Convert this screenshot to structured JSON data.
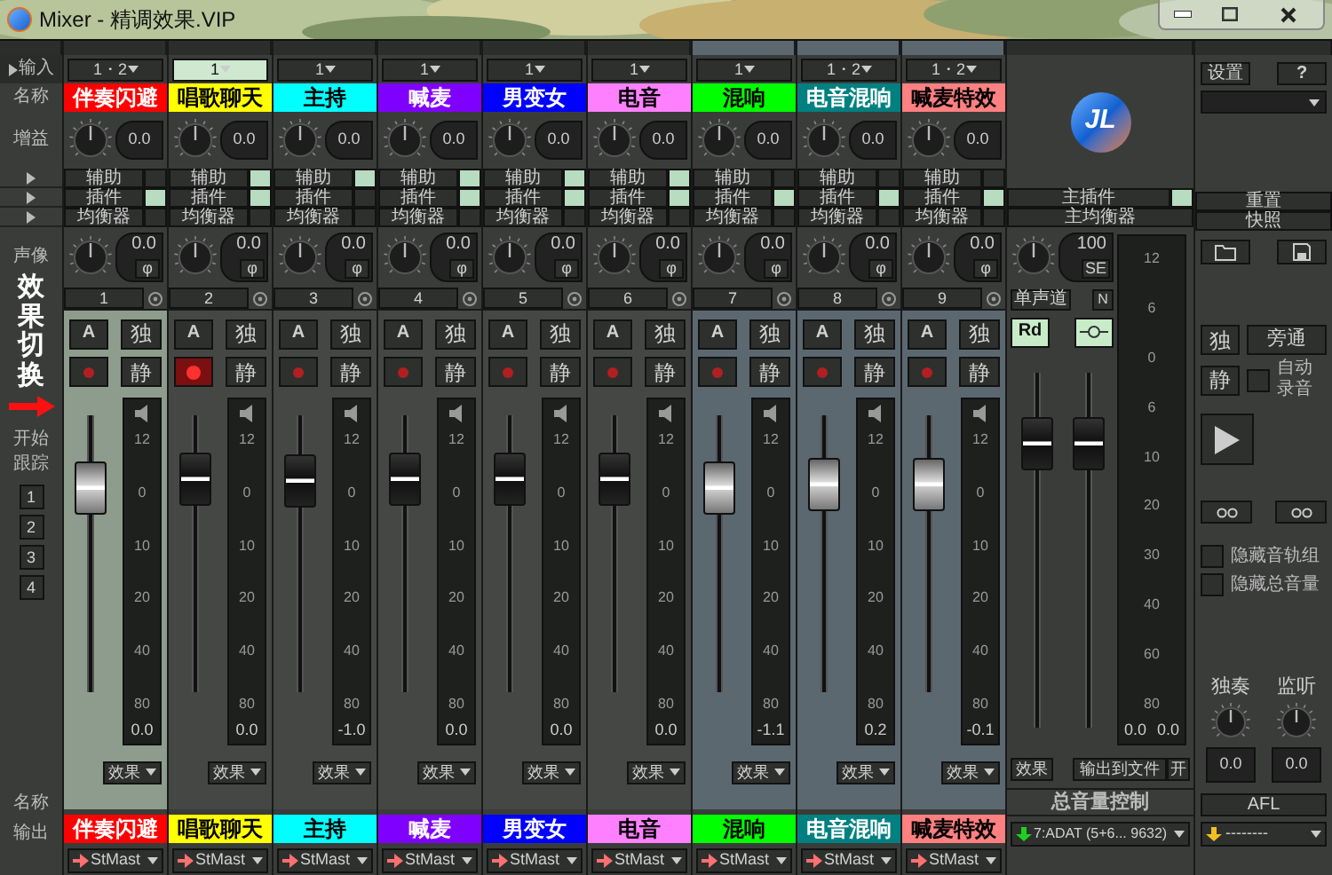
{
  "window": {
    "title": "Mixer - 精调效果.VIP"
  },
  "labels": {
    "input": "输入",
    "name": "名称",
    "gain": "增益",
    "pan": "声像",
    "switch": "效果切换",
    "start": "开始",
    "track": "跟踪",
    "presets": [
      "1",
      "2",
      "3",
      "4"
    ],
    "name_bottom": "名称",
    "output": "输出"
  },
  "channels": [
    {
      "number": "1",
      "input": "1・2",
      "input_active": false,
      "name": "伴奏闪避",
      "color": "#ff0000",
      "gain": "0.0",
      "aux": "辅助",
      "aux_on": false,
      "plugin": "插件",
      "plugin_on": true,
      "eq": "均衡器",
      "pan": "0.0",
      "phase": "φ",
      "auto": "A",
      "solo": "独",
      "mute": "静",
      "record": false,
      "selected": true,
      "grouped": false,
      "level": 0.74,
      "meter_scale": [
        "12",
        "0",
        "10",
        "20",
        "40",
        "80"
      ],
      "reading": "0.0",
      "effect": "效果",
      "name_bottom": "伴奏闪避",
      "output": "StMast"
    },
    {
      "number": "2",
      "input": "1",
      "input_active": true,
      "name": "唱歌聊天",
      "color": "#ffff00",
      "gain": "0.0",
      "aux": "辅助",
      "aux_on": true,
      "plugin": "插件",
      "plugin_on": true,
      "eq": "均衡器",
      "pan": "0.0",
      "phase": "φ",
      "auto": "A",
      "solo": "独",
      "mute": "静",
      "record": true,
      "selected": false,
      "grouped": false,
      "level": 0.77,
      "meter_scale": [
        "12",
        "0",
        "10",
        "20",
        "40",
        "80"
      ],
      "reading": "0.0",
      "effect": "效果",
      "name_bottom": "唱歌聊天",
      "output": "StMast"
    },
    {
      "number": "3",
      "input": "1",
      "input_active": false,
      "name": "主持",
      "color": "#00ffff",
      "gain": "0.0",
      "aux": "辅助",
      "aux_on": true,
      "plugin": "插件",
      "plugin_on": false,
      "eq": "均衡器",
      "pan": "0.0",
      "phase": "φ",
      "auto": "A",
      "solo": "独",
      "mute": "静",
      "record": false,
      "selected": false,
      "grouped": false,
      "level": 0.76,
      "meter_scale": [
        "12",
        "0",
        "10",
        "20",
        "40",
        "80"
      ],
      "reading": "-1.0",
      "effect": "效果",
      "name_bottom": "主持",
      "output": "StMast"
    },
    {
      "number": "4",
      "input": "1",
      "input_active": false,
      "name": "喊麦",
      "color": "#8000ff",
      "gain": "0.0",
      "aux": "辅助",
      "aux_on": true,
      "plugin": "插件",
      "plugin_on": true,
      "eq": "均衡器",
      "pan": "0.0",
      "phase": "φ",
      "auto": "A",
      "solo": "独",
      "mute": "静",
      "record": false,
      "selected": false,
      "grouped": false,
      "level": 0.77,
      "meter_scale": [
        "12",
        "0",
        "10",
        "20",
        "40",
        "80"
      ],
      "reading": "0.0",
      "effect": "效果",
      "name_bottom": "喊麦",
      "output": "StMast"
    },
    {
      "number": "5",
      "input": "1",
      "input_active": false,
      "name": "男变女",
      "color": "#0000ff",
      "gain": "0.0",
      "aux": "辅助",
      "aux_on": true,
      "plugin": "插件",
      "plugin_on": true,
      "eq": "均衡器",
      "pan": "0.0",
      "phase": "φ",
      "auto": "A",
      "solo": "独",
      "mute": "静",
      "record": false,
      "selected": false,
      "grouped": false,
      "level": 0.77,
      "meter_scale": [
        "12",
        "0",
        "10",
        "20",
        "40",
        "80"
      ],
      "reading": "0.0",
      "effect": "效果",
      "name_bottom": "男变女",
      "output": "StMast"
    },
    {
      "number": "6",
      "input": "1",
      "input_active": false,
      "name": "电音",
      "color": "#ff80ff",
      "gain": "0.0",
      "aux": "辅助",
      "aux_on": true,
      "plugin": "插件",
      "plugin_on": true,
      "eq": "均衡器",
      "pan": "0.0",
      "phase": "φ",
      "auto": "A",
      "solo": "独",
      "mute": "静",
      "record": false,
      "selected": false,
      "grouped": false,
      "level": 0.77,
      "meter_scale": [
        "12",
        "0",
        "10",
        "20",
        "40",
        "80"
      ],
      "reading": "0.0",
      "effect": "效果",
      "name_bottom": "电音",
      "output": "StMast"
    },
    {
      "number": "7",
      "input": "1",
      "input_active": false,
      "name": "混响",
      "color": "#00ff00",
      "gain": "0.0",
      "aux": "辅助",
      "aux_on": false,
      "plugin": "插件",
      "plugin_on": true,
      "eq": "均衡器",
      "pan": "0.0",
      "phase": "φ",
      "auto": "A",
      "solo": "独",
      "mute": "静",
      "record": false,
      "selected": false,
      "grouped": true,
      "level": 0.74,
      "meter_scale": [
        "12",
        "0",
        "10",
        "20",
        "40",
        "80"
      ],
      "reading": "-1.1",
      "effect": "效果",
      "name_bottom": "混响",
      "output": "StMast"
    },
    {
      "number": "8",
      "input": "1・2",
      "input_active": false,
      "name": "电音混响",
      "color": "#008080",
      "gain": "0.0",
      "aux": "辅助",
      "aux_on": false,
      "plugin": "插件",
      "plugin_on": true,
      "eq": "均衡器",
      "pan": "0.0",
      "phase": "φ",
      "auto": "A",
      "solo": "独",
      "mute": "静",
      "record": false,
      "selected": false,
      "grouped": true,
      "level": 0.75,
      "meter_scale": [
        "12",
        "0",
        "10",
        "20",
        "40",
        "80"
      ],
      "reading": "0.2",
      "effect": "效果",
      "name_bottom": "电音混响",
      "output": "StMast"
    },
    {
      "number": "9",
      "input": "1・2",
      "input_active": false,
      "name": "喊麦特效",
      "color": "#ff8080",
      "gain": "0.0",
      "aux": "辅助",
      "aux_on": false,
      "plugin": "插件",
      "plugin_on": true,
      "eq": "均衡器",
      "pan": "0.0",
      "phase": "φ",
      "auto": "A",
      "solo": "独",
      "mute": "静",
      "record": false,
      "selected": false,
      "grouped": true,
      "level": 0.75,
      "meter_scale": [
        "12",
        "0",
        "10",
        "20",
        "40",
        "80"
      ],
      "reading": "-0.1",
      "effect": "效果",
      "name_bottom": "喊麦特效",
      "output": "StMast"
    }
  ],
  "master": {
    "logo": "JL",
    "plugin": "主插件",
    "plugin_on": true,
    "eq": "主均衡器",
    "knob_value": "100",
    "se": "SE",
    "mono": "单声道",
    "n": "N",
    "rd": "Rd",
    "rd_on": true,
    "link_on": true,
    "faders": [
      {
        "level": 0.8
      },
      {
        "level": 0.8
      }
    ],
    "meter_scale": [
      "12",
      "6",
      "0",
      "6",
      "10",
      "20",
      "30",
      "40",
      "60",
      "80"
    ],
    "readings": [
      "0.0",
      "0.0"
    ],
    "effect": "效果",
    "export": "输出到文件",
    "export_toggle": "开",
    "name": "总音量控制",
    "output": "7:ADAT (5+6... 9632)"
  },
  "panel": {
    "settings": "设置",
    "help": "?",
    "reset": "重置",
    "snapshot": "快照",
    "solo": "独",
    "bypass": "旁通",
    "mute": "静",
    "auto_record": {
      "label": [
        "自动",
        "录音"
      ],
      "checked": false
    },
    "hide_options": [
      {
        "label": "隐藏音轨组",
        "checked": false
      },
      {
        "label": "隐藏总音量",
        "checked": false
      }
    ],
    "knobs": [
      {
        "label": "独奏",
        "value": "0.0"
      },
      {
        "label": "监听",
        "value": "0.0"
      }
    ],
    "afl": "AFL",
    "output": "--------"
  }
}
